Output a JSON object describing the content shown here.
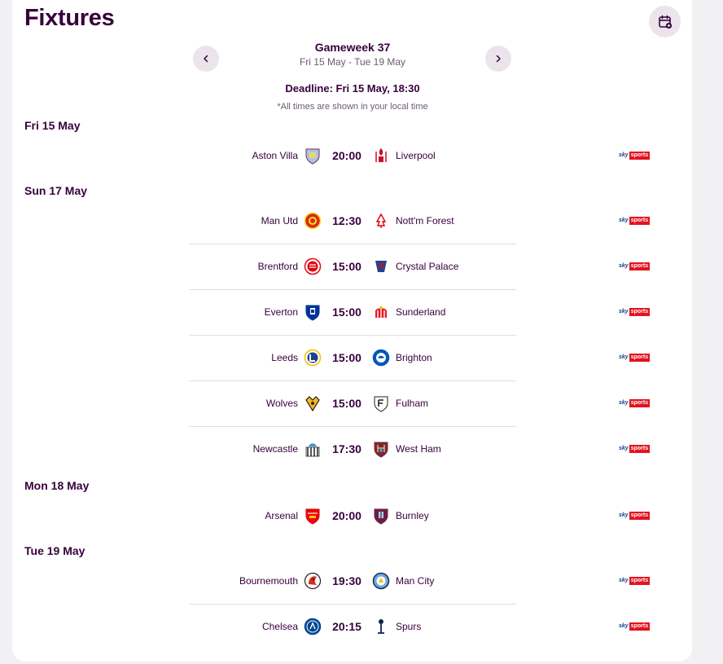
{
  "page": {
    "title": "Fixtures"
  },
  "gameweek": {
    "title": "Gameweek 37",
    "range": "Fri 15 May - Tue 19 May",
    "deadline": "Deadline: Fri 15 May, 18:30",
    "timezone_note": "*All times are shown in your local time"
  },
  "icons": {
    "calendar": "calendar-add-icon",
    "prev": "chevron-left-icon",
    "next": "chevron-right-icon"
  },
  "colors": {
    "brand": "#37003c",
    "sky_blue": "#0b3e8c",
    "sky_red": "#e5121f"
  },
  "broadcaster": {
    "sky": "sky",
    "sports": "sports"
  },
  "days": [
    {
      "label": "Fri 15 May",
      "fixtures": [
        {
          "home": "Aston Villa",
          "time": "20:00",
          "away": "Liverpool"
        }
      ]
    },
    {
      "label": "Sun 17 May",
      "fixtures": [
        {
          "home": "Man Utd",
          "time": "12:30",
          "away": "Nott'm Forest"
        },
        {
          "home": "Brentford",
          "time": "15:00",
          "away": "Crystal Palace"
        },
        {
          "home": "Everton",
          "time": "15:00",
          "away": "Sunderland"
        },
        {
          "home": "Leeds",
          "time": "15:00",
          "away": "Brighton"
        },
        {
          "home": "Wolves",
          "time": "15:00",
          "away": "Fulham"
        },
        {
          "home": "Newcastle",
          "time": "17:30",
          "away": "West Ham"
        }
      ]
    },
    {
      "label": "Mon 18 May",
      "fixtures": [
        {
          "home": "Arsenal",
          "time": "20:00",
          "away": "Burnley"
        }
      ]
    },
    {
      "label": "Tue 19 May",
      "fixtures": [
        {
          "home": "Bournemouth",
          "time": "19:30",
          "away": "Man City"
        },
        {
          "home": "Chelsea",
          "time": "20:15",
          "away": "Spurs"
        }
      ]
    }
  ]
}
